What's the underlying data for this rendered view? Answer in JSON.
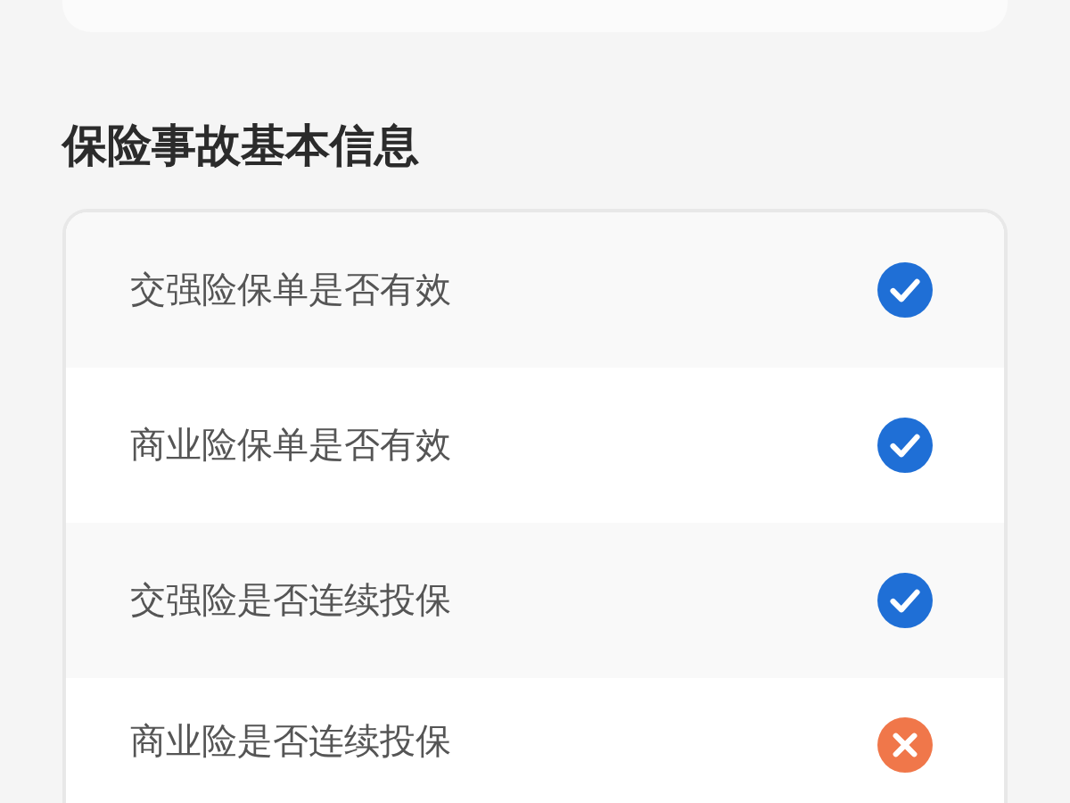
{
  "section_title": "保险事故基本信息",
  "items": [
    {
      "label": "交强险保单是否有效",
      "passed": true
    },
    {
      "label": "商业险保单是否有效",
      "passed": true
    },
    {
      "label": "交强险是否连续投保",
      "passed": true
    },
    {
      "label": "商业险是否连续投保",
      "passed": false
    }
  ]
}
